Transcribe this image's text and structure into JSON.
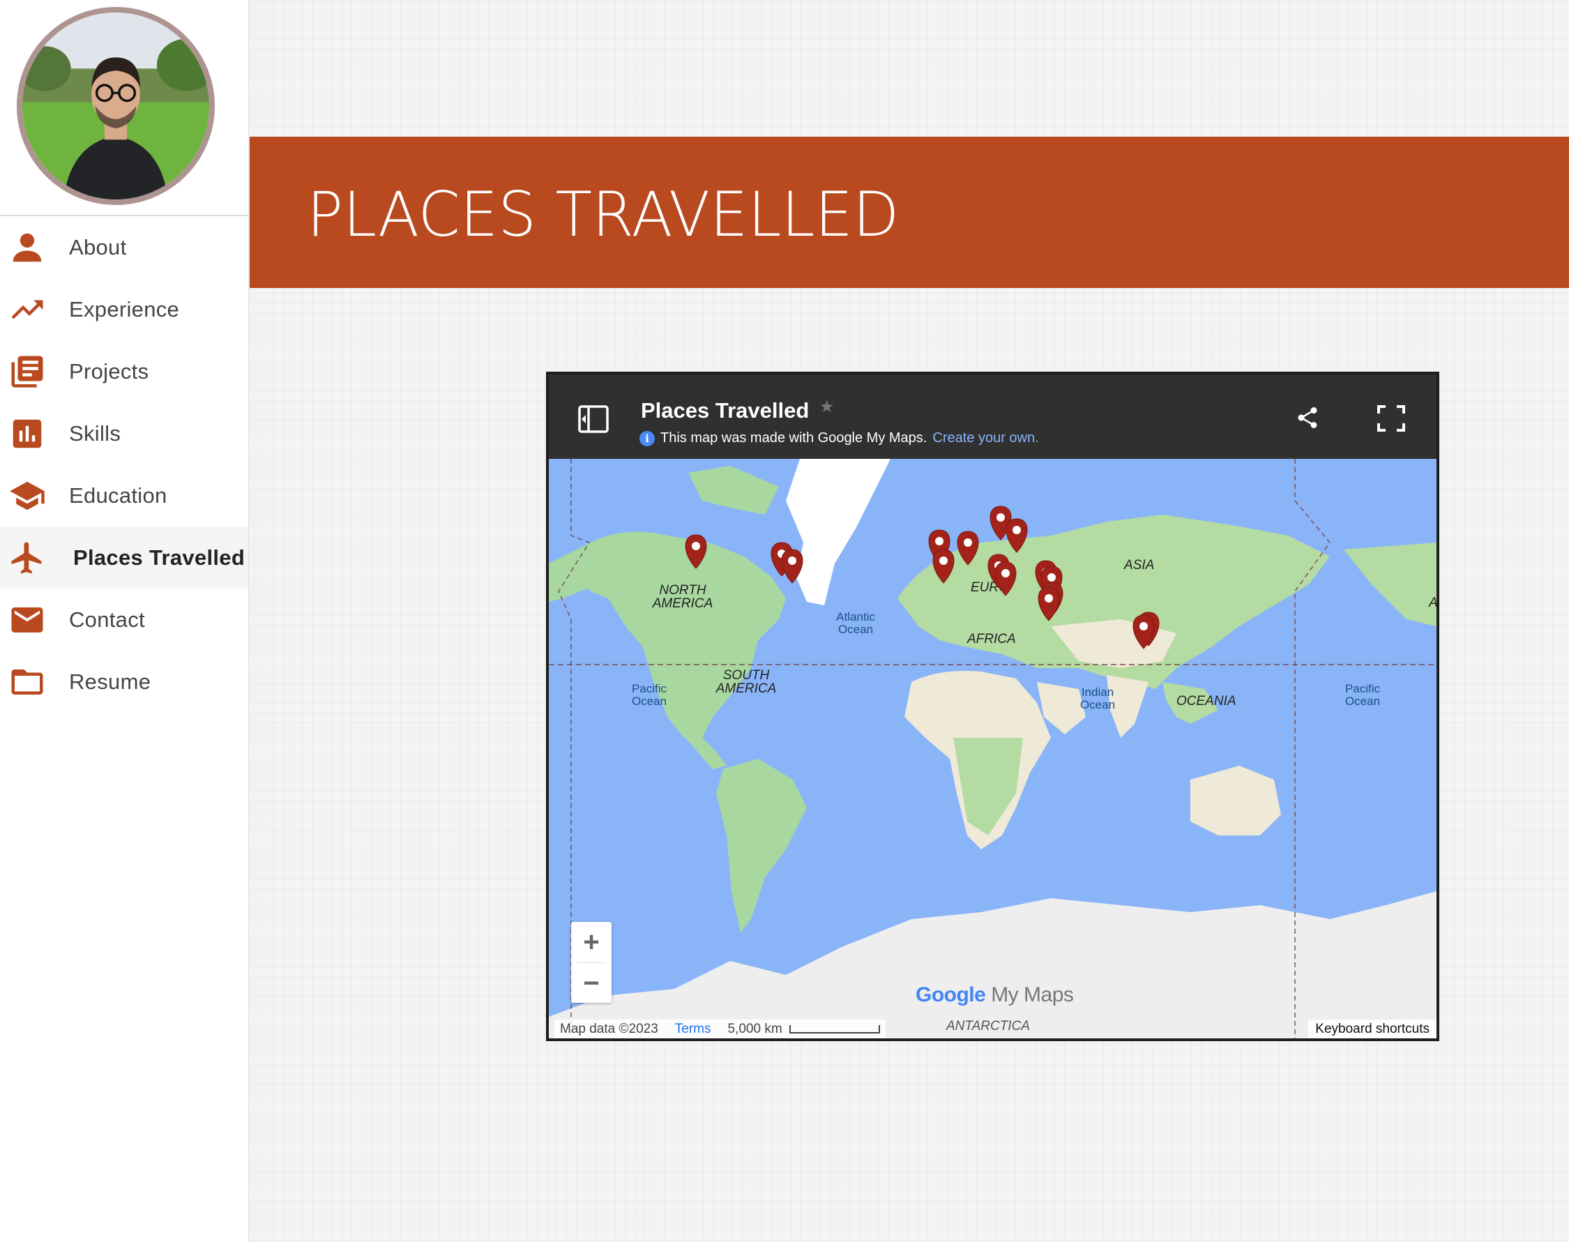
{
  "sidebar": {
    "items": [
      {
        "label": "About",
        "icon": "person-icon"
      },
      {
        "label": "Experience",
        "icon": "trending-up-icon"
      },
      {
        "label": "Projects",
        "icon": "library-books-icon"
      },
      {
        "label": "Skills",
        "icon": "bar-chart-icon"
      },
      {
        "label": "Education",
        "icon": "graduation-cap-icon"
      },
      {
        "label": "Places Travelled",
        "icon": "airplane-icon"
      },
      {
        "label": "Contact",
        "icon": "envelope-icon"
      },
      {
        "label": "Resume",
        "icon": "folder-icon"
      }
    ],
    "active_index": 5,
    "accent_color": "#b94a1f"
  },
  "banner": {
    "title": "PLACES TRAVELLED",
    "background_color": "#b94a1f"
  },
  "map": {
    "title": "Places Travelled",
    "subtitle_text": "This map was made with Google My Maps.",
    "subtitle_link": "Create your own.",
    "zoom_in": "+",
    "zoom_out": "−",
    "logo_google": "Google",
    "logo_my_maps": "My Maps",
    "attribution": "Map data ©2023",
    "terms": "Terms",
    "scale_label": "5,000 km",
    "keyboard_shortcuts": "Keyboard shortcuts",
    "labels": {
      "north_america_1": "NORTH",
      "north_america_2": "AMERICA",
      "south_america_1": "SOUTH",
      "south_america_2": "AMERICA",
      "europe": "EURO",
      "asia": "ASIA",
      "africa": "AFRICA",
      "oceania": "OCEANIA",
      "antarctica": "ANTARCTICA",
      "atlantic_1": "Atlantic",
      "atlantic_2": "Ocean",
      "pacific_west_1": "Pacific",
      "pacific_west_2": "Ocean",
      "indian_1": "Indian",
      "indian_2": "Ocean",
      "pacific_east_1": "Pacific",
      "pacific_east_2": "Ocean",
      "cut_letter": "A"
    },
    "marker_color": "#a3231a",
    "marker_count": 16
  }
}
